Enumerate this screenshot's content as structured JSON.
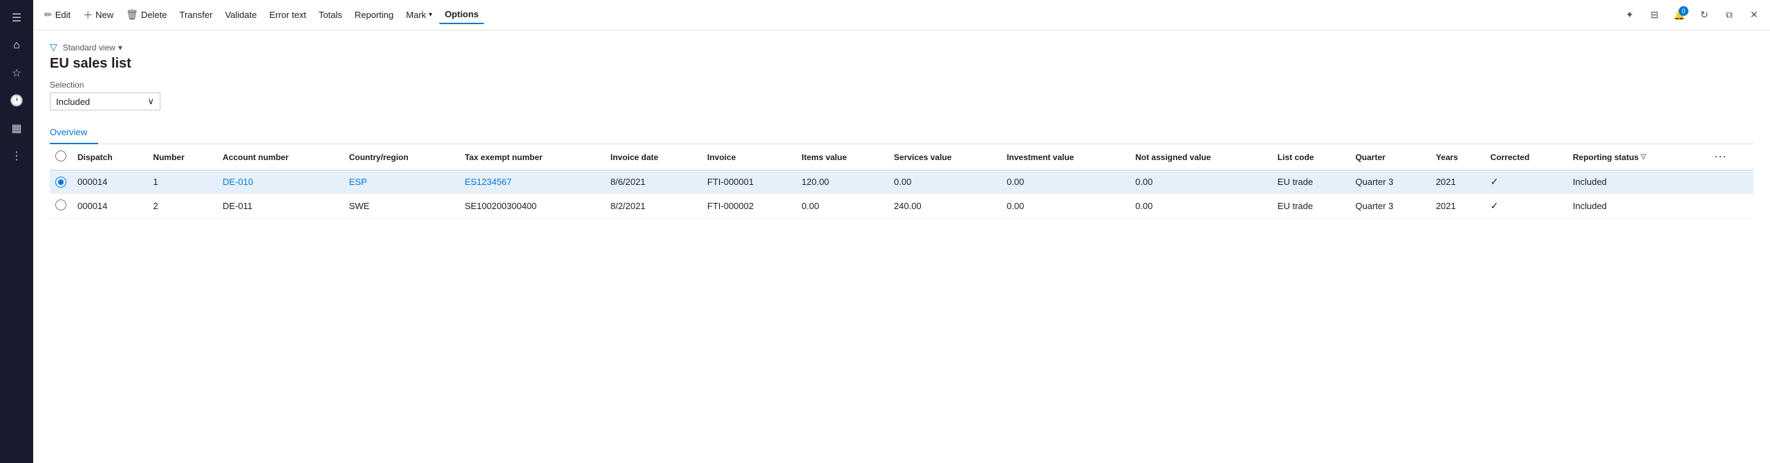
{
  "leftNav": {
    "icons": [
      {
        "name": "menu-icon",
        "symbol": "☰"
      },
      {
        "name": "home-icon",
        "symbol": "⌂"
      },
      {
        "name": "favorites-icon",
        "symbol": "★"
      },
      {
        "name": "recent-icon",
        "symbol": "🕐"
      },
      {
        "name": "workspaces-icon",
        "symbol": "▦"
      },
      {
        "name": "modules-icon",
        "symbol": "≡"
      }
    ]
  },
  "toolbar": {
    "edit_label": "Edit",
    "new_label": "New",
    "delete_label": "Delete",
    "transfer_label": "Transfer",
    "validate_label": "Validate",
    "error_text_label": "Error text",
    "totals_label": "Totals",
    "reporting_label": "Reporting",
    "mark_label": "Mark",
    "options_label": "Options"
  },
  "header": {
    "view_label": "Standard view",
    "page_title": "EU sales list",
    "selection_label": "Selection",
    "selection_value": "Included"
  },
  "tabs": [
    {
      "id": "overview",
      "label": "Overview",
      "active": true
    }
  ],
  "table": {
    "columns": [
      {
        "id": "select",
        "label": ""
      },
      {
        "id": "dispatch",
        "label": "Dispatch"
      },
      {
        "id": "number",
        "label": "Number"
      },
      {
        "id": "account_number",
        "label": "Account number"
      },
      {
        "id": "country_region",
        "label": "Country/region"
      },
      {
        "id": "tax_exempt_number",
        "label": "Tax exempt number"
      },
      {
        "id": "invoice_date",
        "label": "Invoice date"
      },
      {
        "id": "invoice",
        "label": "Invoice"
      },
      {
        "id": "items_value",
        "label": "Items value"
      },
      {
        "id": "services_value",
        "label": "Services value"
      },
      {
        "id": "investment_value",
        "label": "Investment value"
      },
      {
        "id": "not_assigned_value",
        "label": "Not assigned value"
      },
      {
        "id": "list_code",
        "label": "List code"
      },
      {
        "id": "quarter",
        "label": "Quarter"
      },
      {
        "id": "years",
        "label": "Years"
      },
      {
        "id": "corrected",
        "label": "Corrected"
      },
      {
        "id": "reporting_status",
        "label": "Reporting status"
      },
      {
        "id": "actions",
        "label": ""
      }
    ],
    "rows": [
      {
        "selected": true,
        "dispatch": "000014",
        "number": "1",
        "account_number": "DE-010",
        "country_region": "ESP",
        "tax_exempt_number": "ES1234567",
        "invoice_date": "8/6/2021",
        "invoice": "FTI-000001",
        "items_value": "120.00",
        "services_value": "0.00",
        "investment_value": "0.00",
        "not_assigned_value": "0.00",
        "list_code": "EU trade",
        "quarter": "Quarter 3",
        "years": "2021",
        "corrected": "✓",
        "reporting_status": "Included"
      },
      {
        "selected": false,
        "dispatch": "000014",
        "number": "2",
        "account_number": "DE-011",
        "country_region": "SWE",
        "tax_exempt_number": "SE100200300400",
        "invoice_date": "8/2/2021",
        "invoice": "FTI-000002",
        "items_value": "0.00",
        "services_value": "240.00",
        "investment_value": "0.00",
        "not_assigned_value": "0.00",
        "list_code": "EU trade",
        "quarter": "Quarter 3",
        "years": "2021",
        "corrected": "✓",
        "reporting_status": "Included"
      }
    ]
  }
}
